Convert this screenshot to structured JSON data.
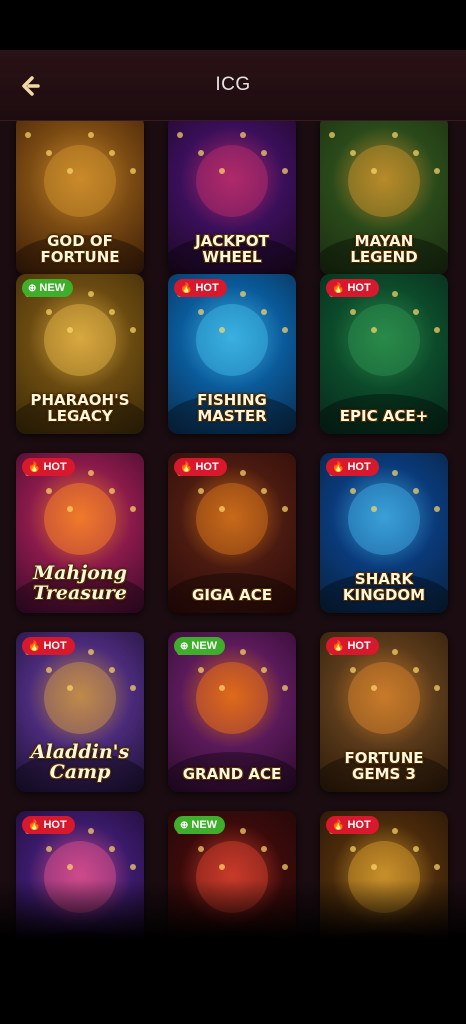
{
  "header": {
    "title": "ICG",
    "back_icon": "back-arrow-icon"
  },
  "colors": {
    "hot": "#d8182c",
    "new": "#3fae2a",
    "header_bg": "#2a1216",
    "page_bg": "#1a0c10"
  },
  "games": [
    {
      "name": "GOD OF FORTUNE",
      "badge": "",
      "style": "caps"
    },
    {
      "name": "JACKPOT WHEEL",
      "badge": "",
      "style": "caps"
    },
    {
      "name": "MAYAN LEGEND",
      "badge": "",
      "style": "caps"
    },
    {
      "name": "PHARAOH'S LEGACY",
      "badge": "NEW",
      "style": "caps"
    },
    {
      "name": "FISHING MASTER",
      "badge": "HOT",
      "style": "caps"
    },
    {
      "name": "EPIC ACE+",
      "badge": "HOT",
      "style": "caps"
    },
    {
      "name": "Mahjong Treasure",
      "badge": "HOT",
      "style": "script"
    },
    {
      "name": "GIGA ACE",
      "badge": "HOT",
      "style": "caps"
    },
    {
      "name": "SHARK KINGDOM",
      "badge": "HOT",
      "style": "caps"
    },
    {
      "name": "Aladdin's Camp",
      "badge": "HOT",
      "style": "script"
    },
    {
      "name": "GRAND ACE",
      "badge": "NEW",
      "style": "caps"
    },
    {
      "name": "FORTUNE GEMS 3",
      "badge": "HOT",
      "style": "caps"
    },
    {
      "name": "",
      "badge": "HOT",
      "style": "caps"
    },
    {
      "name": "",
      "badge": "NEW",
      "style": "caps"
    },
    {
      "name": "",
      "badge": "HOT",
      "style": "caps"
    }
  ]
}
